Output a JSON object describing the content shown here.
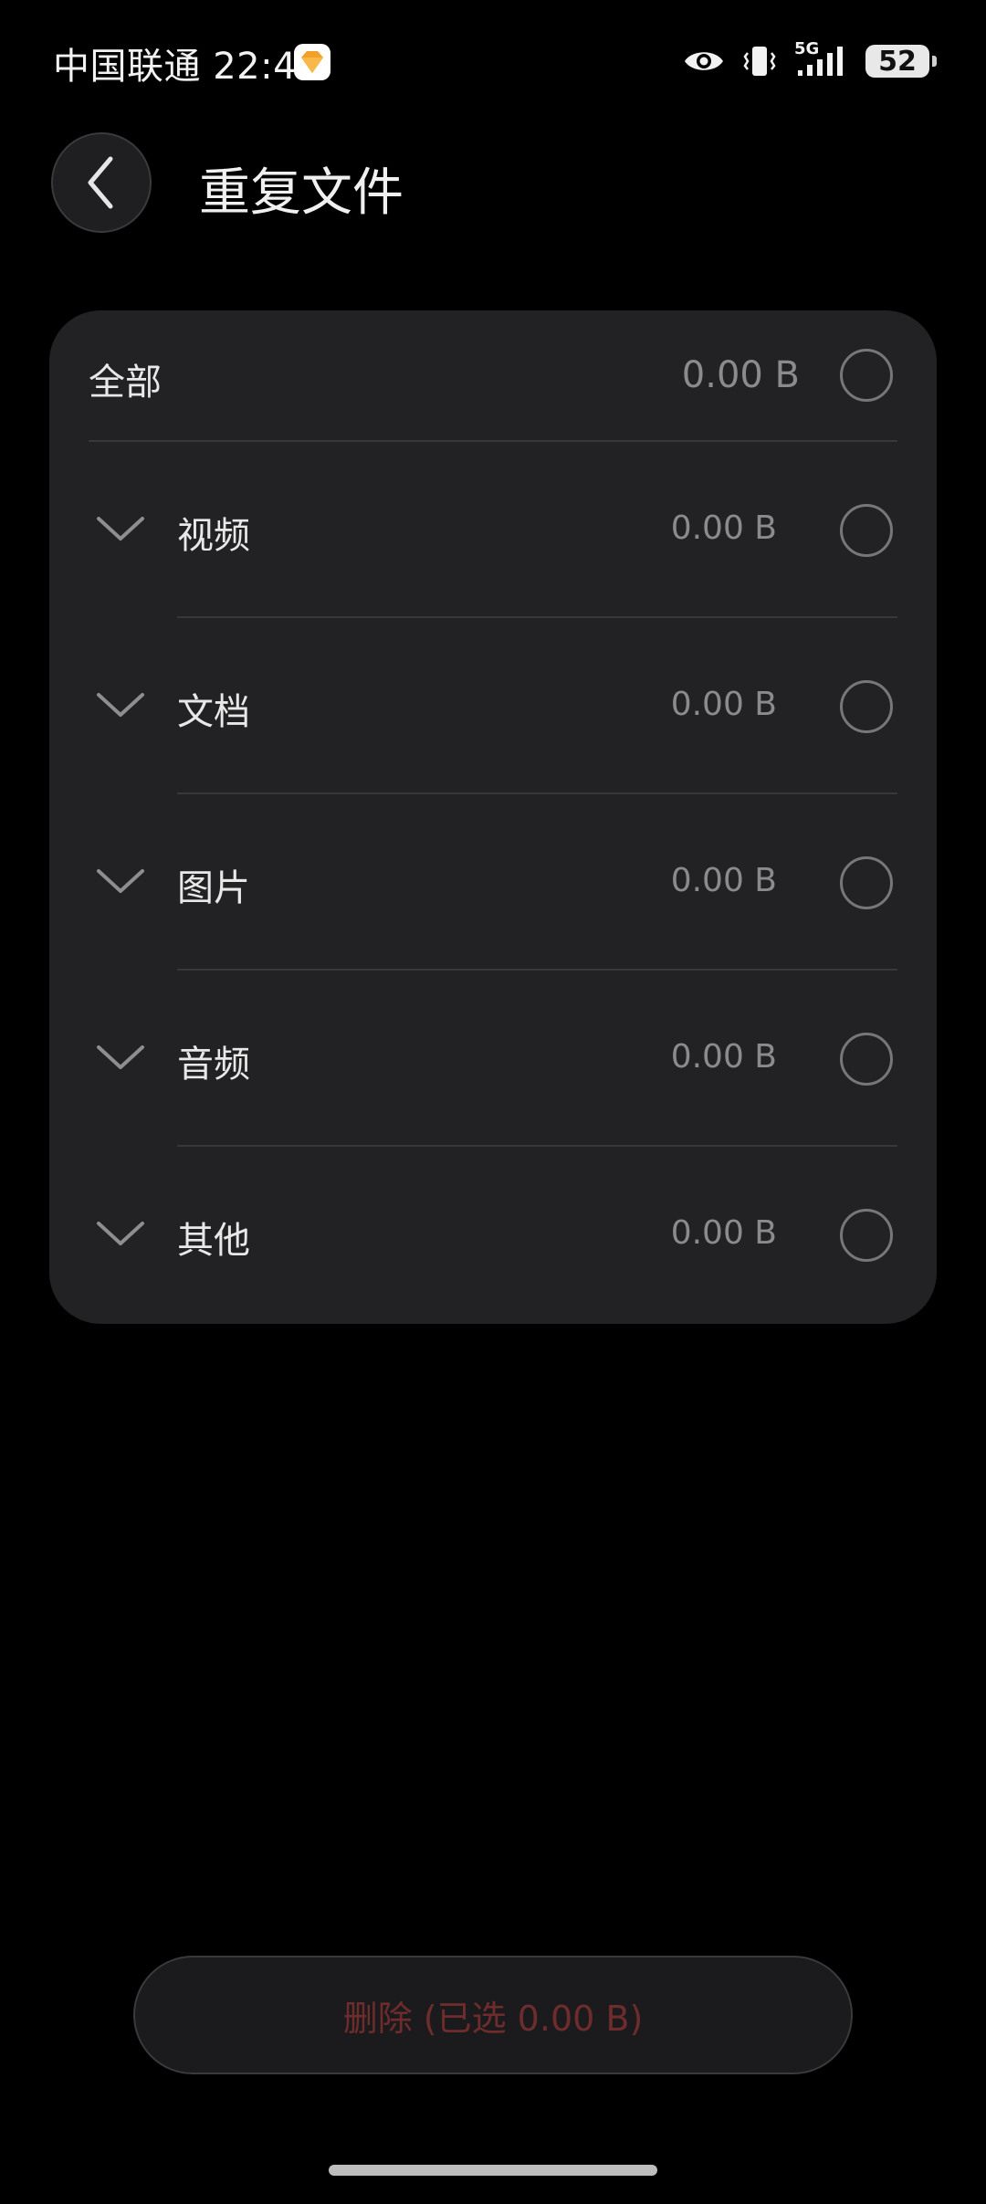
{
  "status_bar": {
    "carrier_time": "中国联通 22:49",
    "network": "5G",
    "battery": "52"
  },
  "header": {
    "title": "重复文件"
  },
  "all_row": {
    "label": "全部",
    "size": "0.00 B"
  },
  "categories": [
    {
      "label": "视频",
      "size": "0.00 B"
    },
    {
      "label": "文档",
      "size": "0.00 B"
    },
    {
      "label": "图片",
      "size": "0.00 B"
    },
    {
      "label": "音频",
      "size": "0.00 B"
    },
    {
      "label": "其他",
      "size": "0.00 B"
    }
  ],
  "footer": {
    "delete_label": "删除 (已选 0.00 B)"
  },
  "colors": {
    "background": "#000000",
    "card": "#222224",
    "delete_text": "#6e2c2c",
    "secondary_text": "#8b8b8d"
  }
}
